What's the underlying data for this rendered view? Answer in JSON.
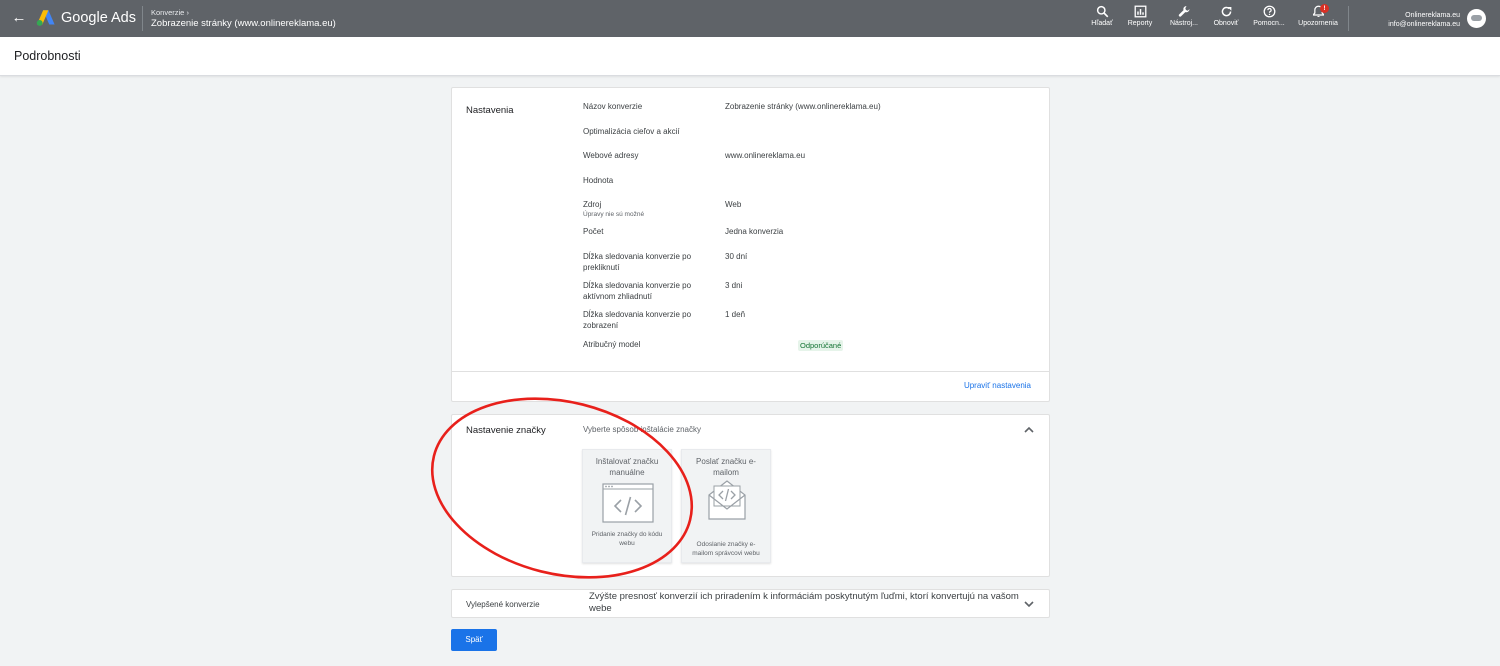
{
  "topbar": {
    "brand": "Google Ads",
    "breadcrumb_parent": "Konverzie",
    "breadcrumb_current": "Zobrazenie stránky (www.onlinereklama.eu)",
    "tools": [
      {
        "label": "Hľadať",
        "icon": "search-icon"
      },
      {
        "label": "Reporty",
        "icon": "reports-icon"
      },
      {
        "label": "Nástroj...",
        "icon": "wrench-icon"
      },
      {
        "label": "Obnoviť",
        "icon": "refresh-icon"
      },
      {
        "label": "Pomocn...",
        "icon": "help-icon"
      },
      {
        "label": "Upozornenia",
        "icon": "bell-icon",
        "badge": "!"
      }
    ],
    "account_name": "Onlinereklama.eu",
    "account_email": "info@onlinereklama.eu"
  },
  "page": {
    "title": "Podrobnosti"
  },
  "settings": {
    "title": "Nastavenia",
    "rows": [
      {
        "label": "Názov konverzie",
        "value": "Zobrazenie stránky (www.onlinereklama.eu)"
      },
      {
        "label": "Optimalizácia cieľov a akcií",
        "value": ""
      },
      {
        "label": "Webové adresy",
        "value": "www.onlinereklama.eu"
      },
      {
        "label": "Hodnota",
        "value": ""
      },
      {
        "label": "Zdroj",
        "sublabel": "Úpravy nie sú možné",
        "value": "Web"
      },
      {
        "label": "Počet",
        "value": "Jedna konverzia"
      },
      {
        "label": "Dĺžka sledovania konverzie po prekliknutí",
        "value": "30 dní"
      },
      {
        "label": "Dĺžka sledovania konverzie po aktívnom zhliadnutí",
        "value": "3 dni"
      },
      {
        "label": "Dĺžka sledovania konverzie po zobrazení",
        "value": "1 deň"
      },
      {
        "label": "Atribučný model",
        "value": "Odporúčané"
      }
    ],
    "edit_link": "Upraviť nastavenia"
  },
  "tag_setup": {
    "title": "Nastavenie značky",
    "hint": "Vyberte spôsob inštalácie značky",
    "options": [
      {
        "title": "Inštalovať značku manuálne",
        "desc": "Pridanie značky do kódu webu",
        "icon": "browser-code-icon"
      },
      {
        "title": "Poslať značku e-mailom",
        "desc": "Odoslanie značky e-mailom správcovi webu",
        "icon": "email-code-icon"
      }
    ]
  },
  "enhanced": {
    "title": "Vylepšené konverzie",
    "desc": "Zvýšte presnosť konverzií ich priradením k informáciám poskytnutým ľuďmi, ktorí konvertujú na vašom webe"
  },
  "actions": {
    "back_label": "Späť"
  },
  "colors": {
    "topbar": "#5f6368",
    "accent": "#1a73e8",
    "annotation": "#e8201b",
    "recommended": "#137333"
  }
}
